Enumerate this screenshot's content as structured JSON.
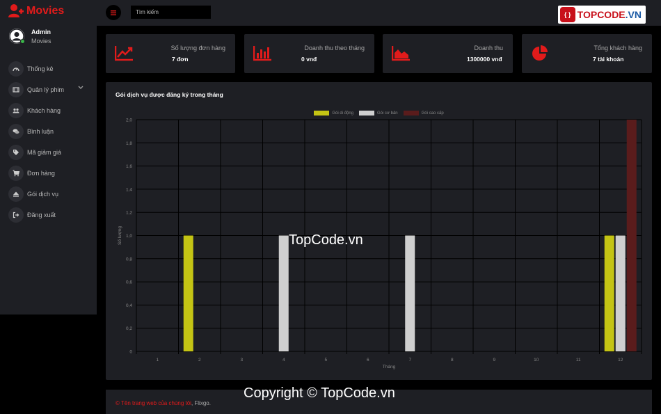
{
  "brand": {
    "name": "Movies"
  },
  "user": {
    "name": "Admin",
    "role": "Movies"
  },
  "sidebar": {
    "items": [
      {
        "label": "Thống kê",
        "icon": "dashboard-icon"
      },
      {
        "label": "Quản lý phim",
        "icon": "film-icon"
      },
      {
        "label": "Khách hàng",
        "icon": "users-icon"
      },
      {
        "label": "Bình luận",
        "icon": "comments-icon"
      },
      {
        "label": "Mã giảm giá",
        "icon": "tags-icon"
      },
      {
        "label": "Đơn hàng",
        "icon": "cart-icon"
      },
      {
        "label": "Gói dịch vụ",
        "icon": "eject-icon"
      },
      {
        "label": "Đăng xuất",
        "icon": "logout-icon"
      }
    ]
  },
  "topbar": {
    "search_placeholder": "Tìm kiếm",
    "logo_mark": "{ }",
    "logo_text_a": "TOPCODE",
    "logo_text_b": ".VN"
  },
  "cards": [
    {
      "label": "Số lượng đơn hàng",
      "value": "7 đơn",
      "icon": "trend-up-icon"
    },
    {
      "label": "Doanh thu theo tháng",
      "value": "0 vnđ",
      "icon": "bar-chart-icon"
    },
    {
      "label": "Doanh thu",
      "value": "1300000 vnđ",
      "icon": "area-chart-icon"
    },
    {
      "label": "Tổng khách hàng",
      "value": "7 tài khoản",
      "icon": "pie-chart-icon"
    }
  ],
  "panel": {
    "title": "Gói dịch vụ được đăng ký trong tháng"
  },
  "colors": {
    "accent": "#e21b1b",
    "panel": "#1e1f24",
    "series1": "#c4c414",
    "series2": "#cfcfcf",
    "series3": "#5a1c1c"
  },
  "chart_data": {
    "type": "bar",
    "categories": [
      "1",
      "2",
      "3",
      "4",
      "5",
      "6",
      "7",
      "8",
      "9",
      "10",
      "11",
      "12"
    ],
    "series": [
      {
        "name": "Gói di động",
        "values": [
          0,
          1,
          0,
          0,
          0,
          0,
          0,
          0,
          0,
          0,
          0,
          1
        ]
      },
      {
        "name": "Gói cơ bản",
        "values": [
          0,
          0,
          0,
          1,
          0,
          0,
          1,
          0,
          0,
          0,
          0,
          1
        ]
      },
      {
        "name": "Gói cao cấp",
        "values": [
          0,
          0,
          0,
          0,
          0,
          0,
          0,
          0,
          0,
          0,
          0,
          2
        ]
      }
    ],
    "yticks": [
      "0",
      "0,2",
      "0,4",
      "0,6",
      "0,8",
      "1,0",
      "1,2",
      "1,4",
      "1,6",
      "1,8",
      "2,0"
    ],
    "xlabel": "Tháng",
    "ylabel": "Số lượng",
    "ylim": [
      0,
      2
    ],
    "grid": true,
    "legend": "top-center"
  },
  "watermark": "TopCode.vn",
  "footer": {
    "copyright": "©",
    "link_text": "Tên trang web của chúng tôi",
    "suffix": ", Flixgo."
  },
  "copyright_overlay": "Copyright © TopCode.vn"
}
